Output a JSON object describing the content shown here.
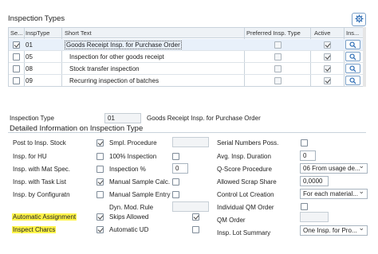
{
  "table": {
    "title": "Inspection Types",
    "columns": [
      "Se...",
      "InspType",
      "Short Text",
      "Preferred Insp. Type",
      "Active",
      "Ins..."
    ],
    "rows": [
      {
        "selected": true,
        "insp_type": "01",
        "short_text": "Goods Receipt Insp. for Purchase Order",
        "preferred": false,
        "active": true
      },
      {
        "selected": false,
        "insp_type": "05",
        "short_text": "Inspection for other goods receipt",
        "preferred": false,
        "active": true
      },
      {
        "selected": false,
        "insp_type": "08",
        "short_text": "Stock transfer inspection",
        "preferred": false,
        "active": true
      },
      {
        "selected": false,
        "insp_type": "09",
        "short_text": "Recurring inspection of batches",
        "preferred": false,
        "active": true
      }
    ]
  },
  "detail": {
    "insp_type_label": "Inspection Type",
    "insp_type_value": "01",
    "insp_type_text": "Goods Receipt Insp. for Purchase Order",
    "section_title": "Detailed Information on Inspection Type",
    "col1": [
      {
        "label": "Post to Insp. Stock",
        "checked": true
      },
      {
        "label": "Insp. for HU",
        "checked": false
      },
      {
        "label": "Insp. with Mat Spec.",
        "checked": false
      },
      {
        "label": "Insp. with Task List",
        "checked": true
      },
      {
        "label": "Insp. by Configuratn",
        "checked": false
      },
      {
        "label": "",
        "checked": null
      },
      {
        "label": "Automatic Assignment",
        "checked": true
      },
      {
        "label": "Inspect Charcs",
        "checked": true
      }
    ],
    "col2": [
      {
        "label": "Smpl. Procedure",
        "type": "field",
        "value": ""
      },
      {
        "label": "100% Inspection",
        "type": "cb",
        "checked": false
      },
      {
        "label": "Inspection %",
        "type": "field",
        "value": "0"
      },
      {
        "label": "Manual Sample Calc.",
        "type": "cb",
        "checked": false
      },
      {
        "label": "Manual Sample Entry",
        "type": "cb",
        "checked": false
      },
      {
        "label": "Dyn. Mod. Rule",
        "type": "field",
        "value": ""
      },
      {
        "label": "Skips Allowed",
        "type": "cb",
        "checked": true
      },
      {
        "label": "Automatic UD",
        "type": "cb",
        "checked": false
      }
    ],
    "col3": [
      {
        "label": "Serial Numbers Poss.",
        "type": "cb",
        "checked": false
      },
      {
        "label": "Avg. Insp. Duration",
        "type": "field",
        "value": "0"
      },
      {
        "label": "Q-Score Procedure",
        "type": "select",
        "value": "06 From usage de..."
      },
      {
        "label": "Allowed Scrap Share",
        "type": "field",
        "value": "0,0000"
      },
      {
        "label": "Control Lot Creation",
        "type": "select",
        "value": "For each material..."
      },
      {
        "label": "Individual QM Order",
        "type": "cb",
        "checked": false
      },
      {
        "label": "QM Order",
        "type": "field",
        "value": ""
      },
      {
        "label": "Insp. Lot Summary",
        "type": "select",
        "value": "One Insp. for Pro..."
      }
    ]
  }
}
